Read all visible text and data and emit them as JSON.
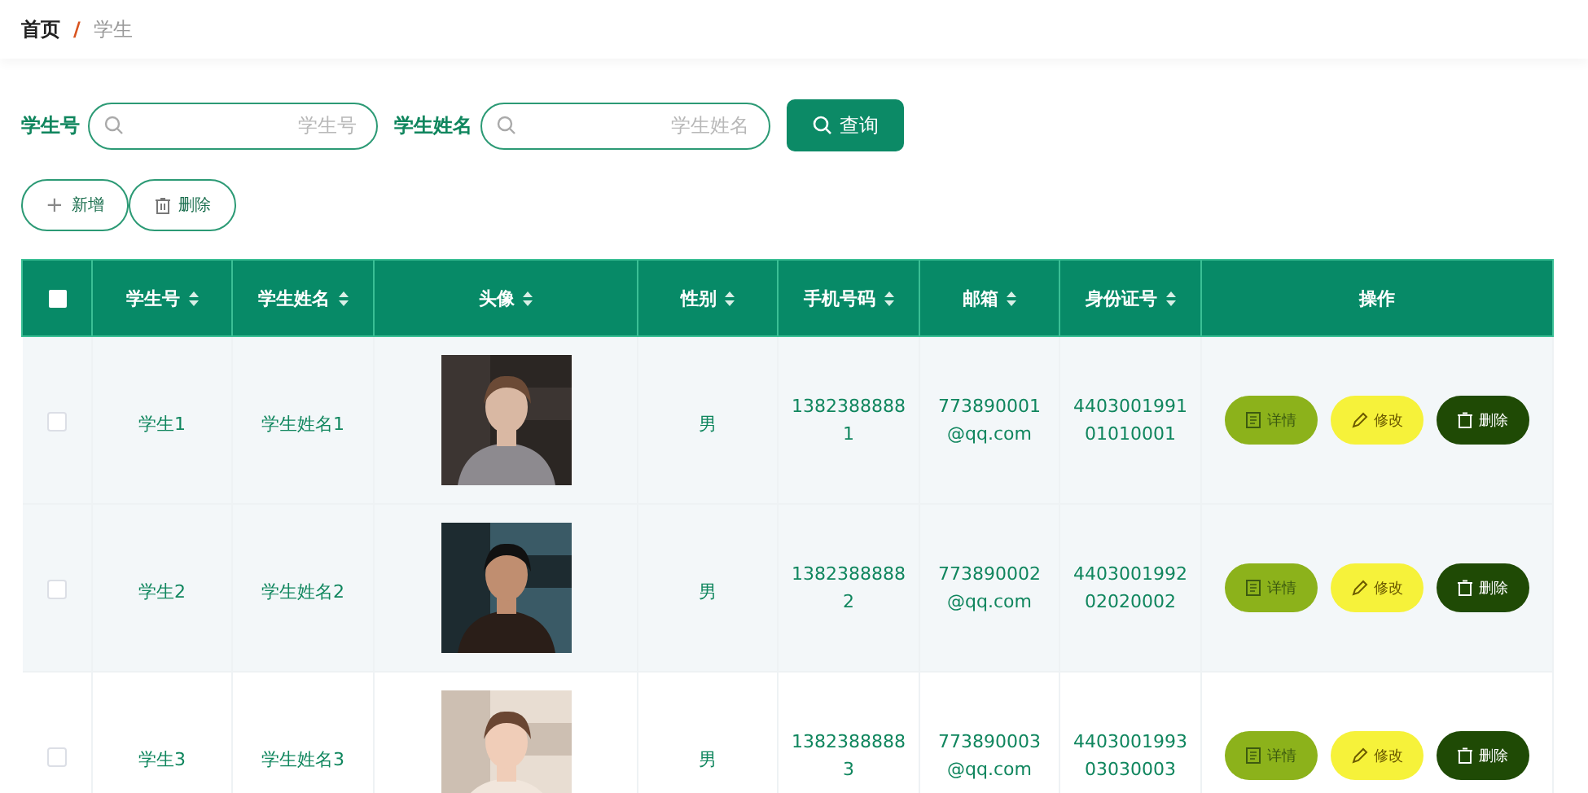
{
  "breadcrumb": [
    {
      "label": "首页",
      "selected": false
    },
    {
      "label": "学生",
      "selected": true
    }
  ],
  "breadcrumb_separator": "/",
  "search": {
    "fields": [
      {
        "label": "学生号",
        "placeholder": "学生号"
      },
      {
        "label": "学生姓名",
        "placeholder": "学生姓名"
      }
    ],
    "button": "查询"
  },
  "actions": [
    {
      "kind": "add",
      "label": "新增",
      "icon": "+"
    },
    {
      "kind": "delete",
      "label": "删除"
    }
  ],
  "table": {
    "columns": [
      "学生号",
      "学生姓名",
      "头像",
      "性别",
      "手机号码",
      "邮箱",
      "身份证号",
      "操作"
    ],
    "header_checked": false,
    "rows": [
      {
        "checked": false,
        "student_no": "学生1",
        "name": "学生姓名1",
        "gender": "男",
        "phone": "13823888881",
        "email": "773890001@qq.com",
        "id_card": "440300199101010001",
        "buttons": [
          {
            "kind": "detail",
            "label": "详情"
          },
          {
            "kind": "edit",
            "label": "修改"
          },
          {
            "kind": "delete",
            "label": "删除"
          }
        ]
      },
      {
        "checked": false,
        "student_no": "学生2",
        "name": "学生姓名2",
        "gender": "男",
        "phone": "13823888882",
        "email": "773890002@qq.com",
        "id_card": "440300199202020002",
        "buttons": [
          {
            "kind": "detail",
            "label": "详情"
          },
          {
            "kind": "edit",
            "label": "修改"
          },
          {
            "kind": "delete",
            "label": "删除"
          }
        ]
      },
      {
        "checked": false,
        "student_no": "学生3",
        "name": "学生姓名3",
        "gender": "男",
        "phone": "13823888883",
        "email": "773890003@qq.com",
        "id_card": "440300199303030003",
        "buttons": [
          {
            "kind": "detail",
            "label": "详情"
          },
          {
            "kind": "edit",
            "label": "修改"
          },
          {
            "kind": "delete",
            "label": "删除"
          }
        ]
      }
    ]
  }
}
